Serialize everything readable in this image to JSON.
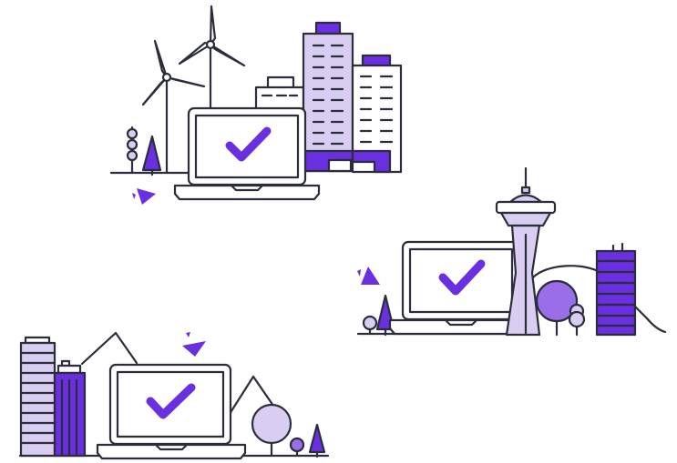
{
  "colors": {
    "accent": "#6a2fe0",
    "accent_light": "#d9cef2",
    "accent_mid": "#9a6ee8",
    "outline": "#2b2d3a",
    "background": "#ffffff"
  },
  "scenes": [
    {
      "name": "city-wind-turbines-scene",
      "icons": [
        "laptop-icon",
        "checkmark-icon",
        "wind-turbine-icon",
        "office-building-icon",
        "tree-icon"
      ]
    },
    {
      "name": "space-needle-scene",
      "icons": [
        "laptop-icon",
        "checkmark-icon",
        "space-needle-tower-icon",
        "office-building-icon",
        "tree-icon"
      ]
    },
    {
      "name": "mountain-city-scene",
      "icons": [
        "laptop-icon",
        "checkmark-icon",
        "office-building-icon",
        "mountain-icon",
        "tree-icon"
      ]
    }
  ]
}
